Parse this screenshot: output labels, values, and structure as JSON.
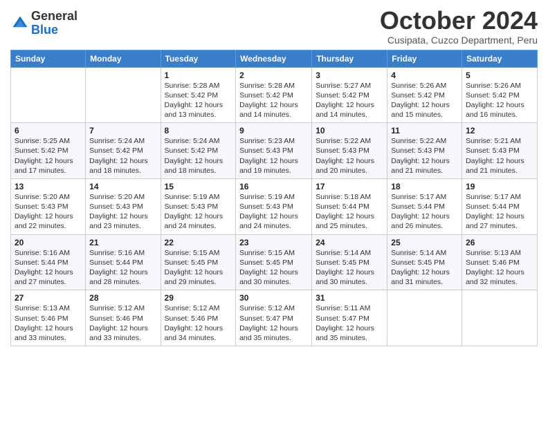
{
  "logo": {
    "general": "General",
    "blue": "Blue"
  },
  "header": {
    "month": "October 2024",
    "location": "Cusipata, Cuzco Department, Peru"
  },
  "days_of_week": [
    "Sunday",
    "Monday",
    "Tuesday",
    "Wednesday",
    "Thursday",
    "Friday",
    "Saturday"
  ],
  "weeks": [
    [
      {
        "day": "",
        "sunrise": "",
        "sunset": "",
        "daylight": ""
      },
      {
        "day": "",
        "sunrise": "",
        "sunset": "",
        "daylight": ""
      },
      {
        "day": "1",
        "sunrise": "Sunrise: 5:28 AM",
        "sunset": "Sunset: 5:42 PM",
        "daylight": "Daylight: 12 hours and 13 minutes."
      },
      {
        "day": "2",
        "sunrise": "Sunrise: 5:28 AM",
        "sunset": "Sunset: 5:42 PM",
        "daylight": "Daylight: 12 hours and 14 minutes."
      },
      {
        "day": "3",
        "sunrise": "Sunrise: 5:27 AM",
        "sunset": "Sunset: 5:42 PM",
        "daylight": "Daylight: 12 hours and 14 minutes."
      },
      {
        "day": "4",
        "sunrise": "Sunrise: 5:26 AM",
        "sunset": "Sunset: 5:42 PM",
        "daylight": "Daylight: 12 hours and 15 minutes."
      },
      {
        "day": "5",
        "sunrise": "Sunrise: 5:26 AM",
        "sunset": "Sunset: 5:42 PM",
        "daylight": "Daylight: 12 hours and 16 minutes."
      }
    ],
    [
      {
        "day": "6",
        "sunrise": "Sunrise: 5:25 AM",
        "sunset": "Sunset: 5:42 PM",
        "daylight": "Daylight: 12 hours and 17 minutes."
      },
      {
        "day": "7",
        "sunrise": "Sunrise: 5:24 AM",
        "sunset": "Sunset: 5:42 PM",
        "daylight": "Daylight: 12 hours and 18 minutes."
      },
      {
        "day": "8",
        "sunrise": "Sunrise: 5:24 AM",
        "sunset": "Sunset: 5:42 PM",
        "daylight": "Daylight: 12 hours and 18 minutes."
      },
      {
        "day": "9",
        "sunrise": "Sunrise: 5:23 AM",
        "sunset": "Sunset: 5:43 PM",
        "daylight": "Daylight: 12 hours and 19 minutes."
      },
      {
        "day": "10",
        "sunrise": "Sunrise: 5:22 AM",
        "sunset": "Sunset: 5:43 PM",
        "daylight": "Daylight: 12 hours and 20 minutes."
      },
      {
        "day": "11",
        "sunrise": "Sunrise: 5:22 AM",
        "sunset": "Sunset: 5:43 PM",
        "daylight": "Daylight: 12 hours and 21 minutes."
      },
      {
        "day": "12",
        "sunrise": "Sunrise: 5:21 AM",
        "sunset": "Sunset: 5:43 PM",
        "daylight": "Daylight: 12 hours and 21 minutes."
      }
    ],
    [
      {
        "day": "13",
        "sunrise": "Sunrise: 5:20 AM",
        "sunset": "Sunset: 5:43 PM",
        "daylight": "Daylight: 12 hours and 22 minutes."
      },
      {
        "day": "14",
        "sunrise": "Sunrise: 5:20 AM",
        "sunset": "Sunset: 5:43 PM",
        "daylight": "Daylight: 12 hours and 23 minutes."
      },
      {
        "day": "15",
        "sunrise": "Sunrise: 5:19 AM",
        "sunset": "Sunset: 5:43 PM",
        "daylight": "Daylight: 12 hours and 24 minutes."
      },
      {
        "day": "16",
        "sunrise": "Sunrise: 5:19 AM",
        "sunset": "Sunset: 5:43 PM",
        "daylight": "Daylight: 12 hours and 24 minutes."
      },
      {
        "day": "17",
        "sunrise": "Sunrise: 5:18 AM",
        "sunset": "Sunset: 5:44 PM",
        "daylight": "Daylight: 12 hours and 25 minutes."
      },
      {
        "day": "18",
        "sunrise": "Sunrise: 5:17 AM",
        "sunset": "Sunset: 5:44 PM",
        "daylight": "Daylight: 12 hours and 26 minutes."
      },
      {
        "day": "19",
        "sunrise": "Sunrise: 5:17 AM",
        "sunset": "Sunset: 5:44 PM",
        "daylight": "Daylight: 12 hours and 27 minutes."
      }
    ],
    [
      {
        "day": "20",
        "sunrise": "Sunrise: 5:16 AM",
        "sunset": "Sunset: 5:44 PM",
        "daylight": "Daylight: 12 hours and 27 minutes."
      },
      {
        "day": "21",
        "sunrise": "Sunrise: 5:16 AM",
        "sunset": "Sunset: 5:44 PM",
        "daylight": "Daylight: 12 hours and 28 minutes."
      },
      {
        "day": "22",
        "sunrise": "Sunrise: 5:15 AM",
        "sunset": "Sunset: 5:45 PM",
        "daylight": "Daylight: 12 hours and 29 minutes."
      },
      {
        "day": "23",
        "sunrise": "Sunrise: 5:15 AM",
        "sunset": "Sunset: 5:45 PM",
        "daylight": "Daylight: 12 hours and 30 minutes."
      },
      {
        "day": "24",
        "sunrise": "Sunrise: 5:14 AM",
        "sunset": "Sunset: 5:45 PM",
        "daylight": "Daylight: 12 hours and 30 minutes."
      },
      {
        "day": "25",
        "sunrise": "Sunrise: 5:14 AM",
        "sunset": "Sunset: 5:45 PM",
        "daylight": "Daylight: 12 hours and 31 minutes."
      },
      {
        "day": "26",
        "sunrise": "Sunrise: 5:13 AM",
        "sunset": "Sunset: 5:46 PM",
        "daylight": "Daylight: 12 hours and 32 minutes."
      }
    ],
    [
      {
        "day": "27",
        "sunrise": "Sunrise: 5:13 AM",
        "sunset": "Sunset: 5:46 PM",
        "daylight": "Daylight: 12 hours and 33 minutes."
      },
      {
        "day": "28",
        "sunrise": "Sunrise: 5:12 AM",
        "sunset": "Sunset: 5:46 PM",
        "daylight": "Daylight: 12 hours and 33 minutes."
      },
      {
        "day": "29",
        "sunrise": "Sunrise: 5:12 AM",
        "sunset": "Sunset: 5:46 PM",
        "daylight": "Daylight: 12 hours and 34 minutes."
      },
      {
        "day": "30",
        "sunrise": "Sunrise: 5:12 AM",
        "sunset": "Sunset: 5:47 PM",
        "daylight": "Daylight: 12 hours and 35 minutes."
      },
      {
        "day": "31",
        "sunrise": "Sunrise: 5:11 AM",
        "sunset": "Sunset: 5:47 PM",
        "daylight": "Daylight: 12 hours and 35 minutes."
      },
      {
        "day": "",
        "sunrise": "",
        "sunset": "",
        "daylight": ""
      },
      {
        "day": "",
        "sunrise": "",
        "sunset": "",
        "daylight": ""
      }
    ]
  ]
}
